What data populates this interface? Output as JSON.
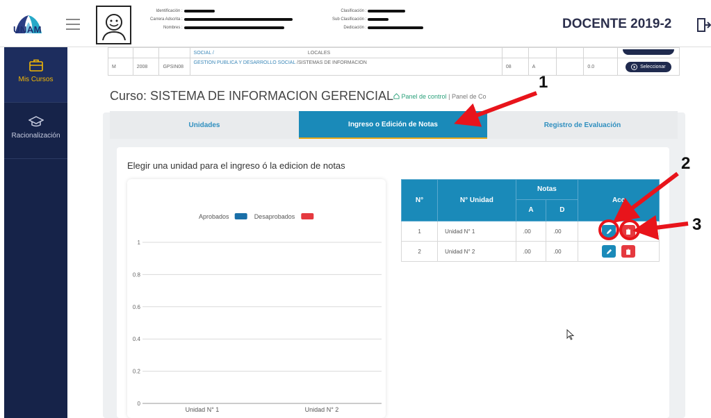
{
  "header": {
    "logo_text": "UNAM",
    "info_left": [
      "Identificación :",
      "Carrera Adscrita :",
      "Nombres :"
    ],
    "info_right": [
      "Clasificación :",
      "Sub Clasificación :",
      "Dedicación :"
    ],
    "docente": "DOCENTE 2019-2",
    "icons": [
      "hamburger-icon",
      "avatar-icon",
      "logout-icon"
    ]
  },
  "sidebar": {
    "items": [
      {
        "label": "Mis Cursos",
        "icon": "briefcase-icon",
        "active": true
      },
      {
        "label": "Racionalización",
        "icon": "graduation-cap-icon",
        "active": false
      }
    ]
  },
  "course_table": {
    "partial_row": {
      "course": "SOCIAL /",
      "career": "LOCALES"
    },
    "row": {
      "col1": "M",
      "col2": "2008",
      "code": "GPSIN08",
      "course": "GESTION PUBLICA Y DESARROLLO SOCIAL",
      "career": "/SISTEMAS DE INFORMACION",
      "cycle": "08",
      "section": "A",
      "empty": "",
      "value": "0.0",
      "button": "Seleccionar"
    }
  },
  "course": {
    "title": "Curso: SISTEMA DE INFORMACION GERENCIAL",
    "crumb_home": "Panel de control",
    "crumb_sep": "|",
    "crumb_current": "Panel de Co"
  },
  "tabs": [
    {
      "label": "Unidades",
      "active": false
    },
    {
      "label": "Ingreso o Edición de Notas",
      "active": true
    },
    {
      "label": "Registro de Evaluación",
      "active": false
    }
  ],
  "main": {
    "instruction": "Elegir una unidad para el ingreso ó la edicion de notas"
  },
  "chart_data": {
    "type": "bar",
    "categories": [
      "Unidad N° 1",
      "Unidad N° 2"
    ],
    "series": [
      {
        "name": "Aprobados",
        "values": [
          0,
          0
        ],
        "color": "#1a6fa8"
      },
      {
        "name": "Desaprobados",
        "values": [
          0,
          0
        ],
        "color": "#e5393f"
      }
    ],
    "ylim": [
      0,
      1
    ],
    "yticks": [
      "0",
      "0.2",
      "0.4",
      "0.6",
      "0.8",
      "1"
    ],
    "grid": true,
    "legend": "top-center"
  },
  "notes_table": {
    "headers": {
      "num": "N°",
      "unit": "N° Unidad",
      "notas": "Notas",
      "a": "A",
      "d": "D",
      "actions": "Acc"
    },
    "rows": [
      {
        "num": "1",
        "unit": "Unidad N° 1",
        "a": ".00",
        "d": ".00"
      },
      {
        "num": "2",
        "unit": "Unidad N° 2",
        "a": ".00",
        "d": ".00"
      }
    ],
    "action_icons": [
      "pencil-icon",
      "trash-icon"
    ]
  },
  "annotations": {
    "n1": "1",
    "n2": "2",
    "n3": "3",
    "color": "#e8141b"
  }
}
